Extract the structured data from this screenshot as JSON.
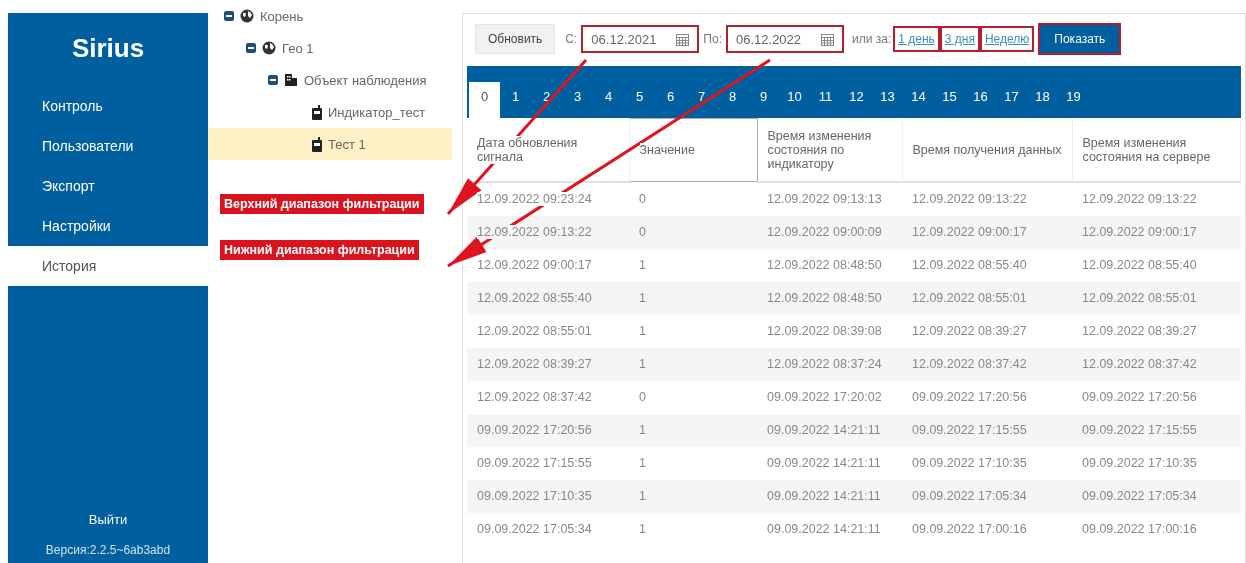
{
  "sidebar": {
    "logo": "Sirius",
    "items": [
      {
        "label": "Контроль",
        "selected": false
      },
      {
        "label": "Пользователи",
        "selected": false
      },
      {
        "label": "Экспорт",
        "selected": false
      },
      {
        "label": "Настройки",
        "selected": false
      },
      {
        "label": "История",
        "selected": true
      }
    ],
    "logout": "Выйти",
    "version": "Версия:2.2.5~6ab3abd"
  },
  "tree": [
    {
      "label": "Корень",
      "kind": "globe",
      "expanded": true,
      "selected": false,
      "children": [
        {
          "label": "Гео 1",
          "kind": "globe",
          "expanded": true,
          "selected": false,
          "children": [
            {
              "label": "Объект наблюдения",
              "kind": "building",
              "expanded": true,
              "selected": false,
              "children": [
                {
                  "label": "Индикатор_тест",
                  "kind": "device",
                  "selected": false
                },
                {
                  "label": "Тест 1",
                  "kind": "device",
                  "selected": true
                }
              ]
            }
          ]
        }
      ]
    }
  ],
  "annotations": [
    {
      "label": "Верхний диапазон фильтрации"
    },
    {
      "label": "Нижний диапазон фильтрации"
    }
  ],
  "toolbar": {
    "refresh": "Обновить",
    "from_field": {
      "label": "С:",
      "value": "06.12.2021",
      "highlighted": true
    },
    "to_field": {
      "label": "По:",
      "value": "06.12.2022",
      "highlighted": true
    },
    "or_label": "или за:",
    "quick_links": [
      {
        "label": "1 день",
        "highlighted": true
      },
      {
        "label": "3 дня",
        "highlighted": true
      },
      {
        "label": "Неделю",
        "highlighted": true
      }
    ],
    "show_button": {
      "label": "Показать",
      "highlighted": true
    }
  },
  "tabs": [
    {
      "label": "0",
      "selected": true
    },
    {
      "label": "1",
      "selected": false
    },
    {
      "label": "2",
      "selected": false
    },
    {
      "label": "3",
      "selected": false
    },
    {
      "label": "4",
      "selected": false
    },
    {
      "label": "5",
      "selected": false
    },
    {
      "label": "6",
      "selected": false
    },
    {
      "label": "7",
      "selected": false
    },
    {
      "label": "8",
      "selected": false
    },
    {
      "label": "9",
      "selected": false
    },
    {
      "label": "10",
      "selected": false
    },
    {
      "label": "11",
      "selected": false
    },
    {
      "label": "12",
      "selected": false
    },
    {
      "label": "13",
      "selected": false
    },
    {
      "label": "14",
      "selected": false
    },
    {
      "label": "15",
      "selected": false
    },
    {
      "label": "16",
      "selected": false
    },
    {
      "label": "17",
      "selected": false
    },
    {
      "label": "18",
      "selected": false
    },
    {
      "label": "19",
      "selected": false
    }
  ],
  "table": {
    "columns": [
      {
        "label": "Дата обновления сигнала",
        "selected": false
      },
      {
        "label": "Значение",
        "selected": true
      },
      {
        "label": "Время изменения состояния по индикатору",
        "selected": false
      },
      {
        "label": "Время получения данных",
        "selected": false
      },
      {
        "label": "Время изменения состояния на сервере",
        "selected": false
      }
    ],
    "rows": [
      [
        "12.09.2022 09:23:24",
        "0",
        "12.09.2022 09:13:13",
        "12.09.2022 09:13:22",
        "12.09.2022 09:13:22"
      ],
      [
        "12.09.2022 09:13:22",
        "0",
        "12.09.2022 09:00:09",
        "12.09.2022 09:00:17",
        "12.09.2022 09:00:17"
      ],
      [
        "12.09.2022 09:00:17",
        "1",
        "12.09.2022 08:48:50",
        "12.09.2022 08:55:40",
        "12.09.2022 08:55:40"
      ],
      [
        "12.09.2022 08:55:40",
        "1",
        "12.09.2022 08:48:50",
        "12.09.2022 08:55:01",
        "12.09.2022 08:55:01"
      ],
      [
        "12.09.2022 08:55:01",
        "1",
        "12.09.2022 08:39:08",
        "12.09.2022 08:39:27",
        "12.09.2022 08:39:27"
      ],
      [
        "12.09.2022 08:39:27",
        "1",
        "12.09.2022 08:37:24",
        "12.09.2022 08:37:42",
        "12.09.2022 08:37:42"
      ],
      [
        "12.09.2022 08:37:42",
        "0",
        "09.09.2022 17:20:02",
        "09.09.2022 17:20:56",
        "09.09.2022 17:20:56"
      ],
      [
        "09.09.2022 17:20:56",
        "1",
        "09.09.2022 14:21:11",
        "09.09.2022 17:15:55",
        "09.09.2022 17:15:55"
      ],
      [
        "09.09.2022 17:15:55",
        "1",
        "09.09.2022 14:21:11",
        "09.09.2022 17:10:35",
        "09.09.2022 17:10:35"
      ],
      [
        "09.09.2022 17:10:35",
        "1",
        "09.09.2022 14:21:11",
        "09.09.2022 17:05:34",
        "09.09.2022 17:05:34"
      ],
      [
        "09.09.2022 17:05:34",
        "1",
        "09.09.2022 14:21:11",
        "09.09.2022 17:00:16",
        "09.09.2022 17:00:16"
      ]
    ]
  }
}
